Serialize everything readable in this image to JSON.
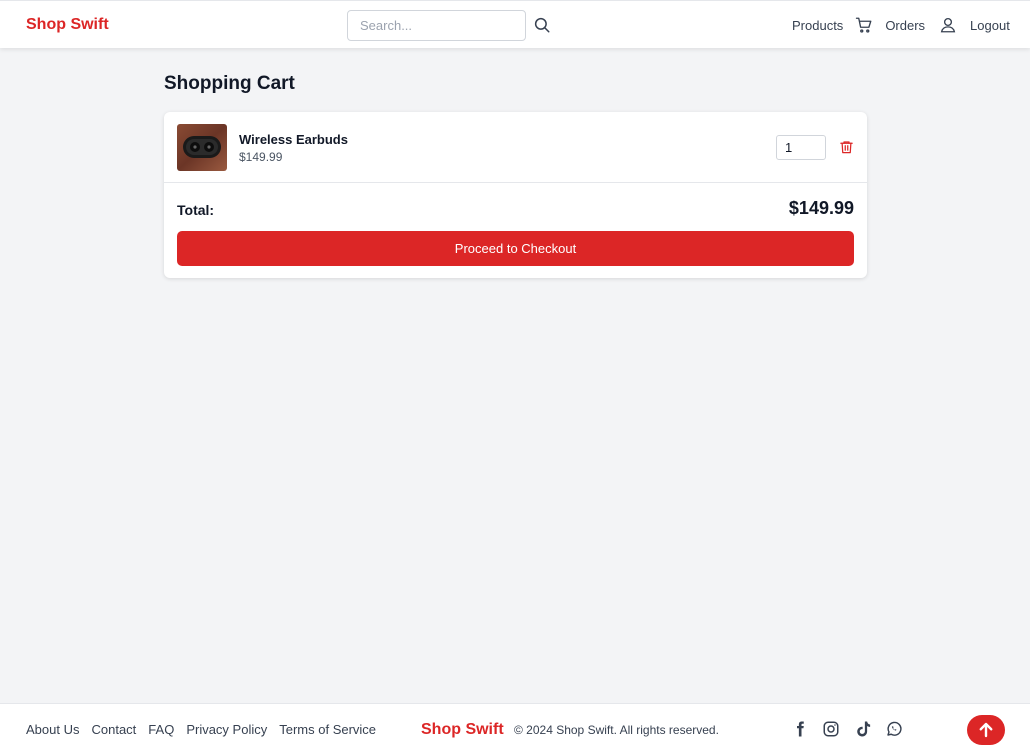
{
  "header": {
    "logo": "Shop Swift",
    "search_placeholder": "Search...",
    "nav": {
      "products": "Products",
      "orders": "Orders",
      "logout": "Logout"
    }
  },
  "cart": {
    "title": "Shopping Cart",
    "items": [
      {
        "name": "Wireless Earbuds",
        "price": "$149.99",
        "quantity": "1"
      }
    ],
    "total_label": "Total:",
    "total_value": "$149.99",
    "checkout_label": "Proceed to Checkout"
  },
  "footer": {
    "links": [
      "About Us",
      "Contact",
      "FAQ",
      "Privacy Policy",
      "Terms of Service"
    ],
    "logo": "Shop Swift",
    "copyright": "© 2024 Shop Swift. All rights reserved.",
    "social_icons": [
      "facebook-icon",
      "instagram-icon",
      "tiktok-icon",
      "whatsapp-icon"
    ]
  },
  "colors": {
    "accent": "#dc2626",
    "background": "#f3f4f6",
    "text": "#111827"
  }
}
